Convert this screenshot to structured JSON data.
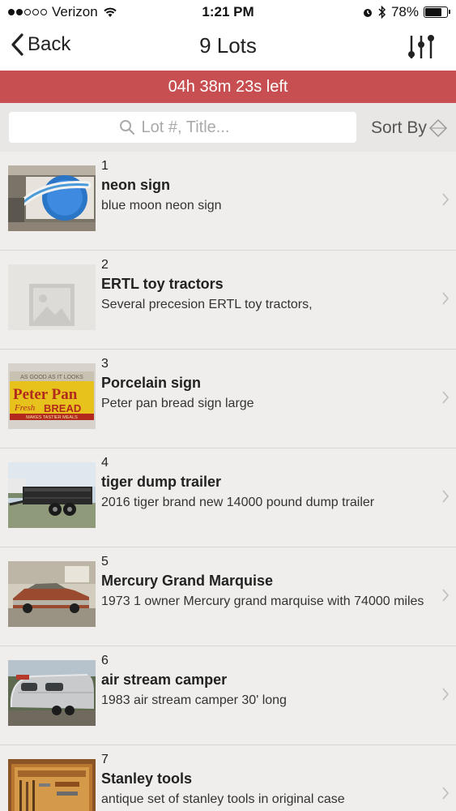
{
  "status_bar": {
    "carrier": "Verizon",
    "time": "1:21 PM",
    "battery": "78%",
    "battery_level": 0.78
  },
  "nav": {
    "back_label": "Back",
    "title": "9 Lots"
  },
  "timer": {
    "text": "04h 38m 23s left",
    "color": "#c84f51"
  },
  "search": {
    "placeholder": "Lot #, Title...",
    "value": ""
  },
  "sort": {
    "label": "Sort By"
  },
  "lots": [
    {
      "number": "1",
      "title": "neon sign",
      "description": "blue moon neon sign",
      "image": "blue-moon-sign-photo"
    },
    {
      "number": "2",
      "title": "ERTL toy tractors",
      "description": "Several precesion ERTL toy tractors,",
      "image": "placeholder-image-icon"
    },
    {
      "number": "3",
      "title": "Porcelain sign",
      "description": "Peter pan bread sign large",
      "image": "peter-pan-sign-photo"
    },
    {
      "number": "4",
      "title": "tiger dump trailer",
      "description": "2016 tiger brand new 14000 pound dump trailer",
      "image": "trailer-photo"
    },
    {
      "number": "5",
      "title": "Mercury Grand Marquise",
      "description": "1973 1 owner Mercury grand marquise with 74000 miles",
      "image": "car-photo"
    },
    {
      "number": "6",
      "title": "air stream camper",
      "description": "1983 air stream camper 30' long",
      "image": "camper-photo"
    },
    {
      "number": "7",
      "title": "Stanley tools",
      "description": "antique set of stanley tools in original case",
      "image": "tools-photo"
    }
  ]
}
